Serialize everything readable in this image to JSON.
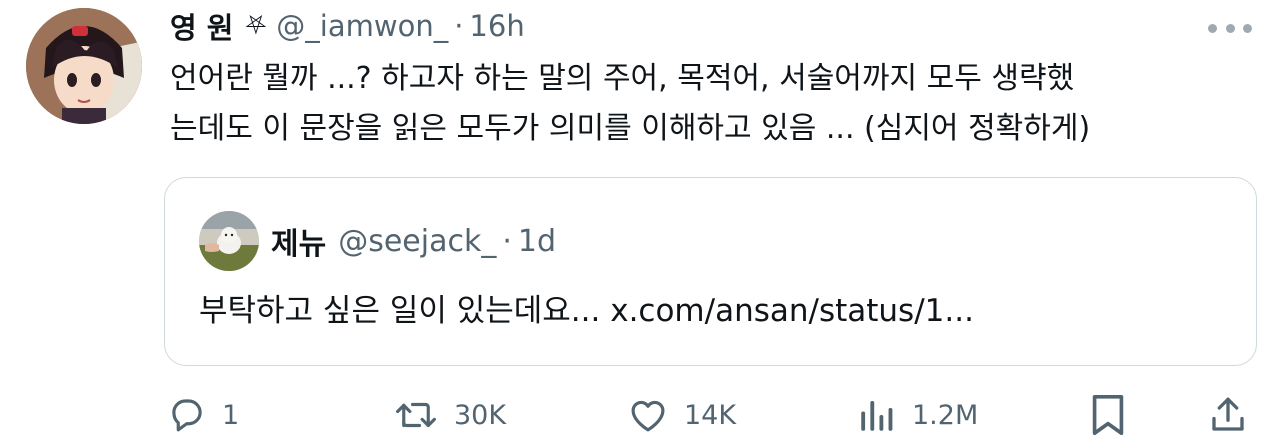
{
  "author": {
    "name": "영 원",
    "name_emoji": "⛧",
    "handle": "@_iamwon_",
    "time": "16h"
  },
  "tweet": {
    "line1": "언어란 뭘까 ...? 하고자 하는 말의 주어, 목적어, 서술어까지 모두 생략했",
    "line2": "는데도 이 문장을 읽은 모두가 의미를 이해하고 있음 ... (심지어 정확하게)"
  },
  "quote": {
    "name": "제뉴",
    "handle": "@seejack_",
    "time": "1d",
    "text": "부탁하고 싶은 일이 있는데요... x.com/ansan/status/1..."
  },
  "separator": "·",
  "actions": {
    "reply": {
      "icon": "reply-icon",
      "count": "1"
    },
    "retweet": {
      "icon": "retweet-icon",
      "count": "30K"
    },
    "like": {
      "icon": "heart-icon",
      "count": "14K"
    },
    "views": {
      "icon": "views-icon",
      "count": "1.2M"
    },
    "bookmark": {
      "icon": "bookmark-icon"
    },
    "share": {
      "icon": "share-icon"
    }
  },
  "colors": {
    "text": "#0f1419",
    "secondary": "#536471",
    "border": "#cfd9de"
  }
}
